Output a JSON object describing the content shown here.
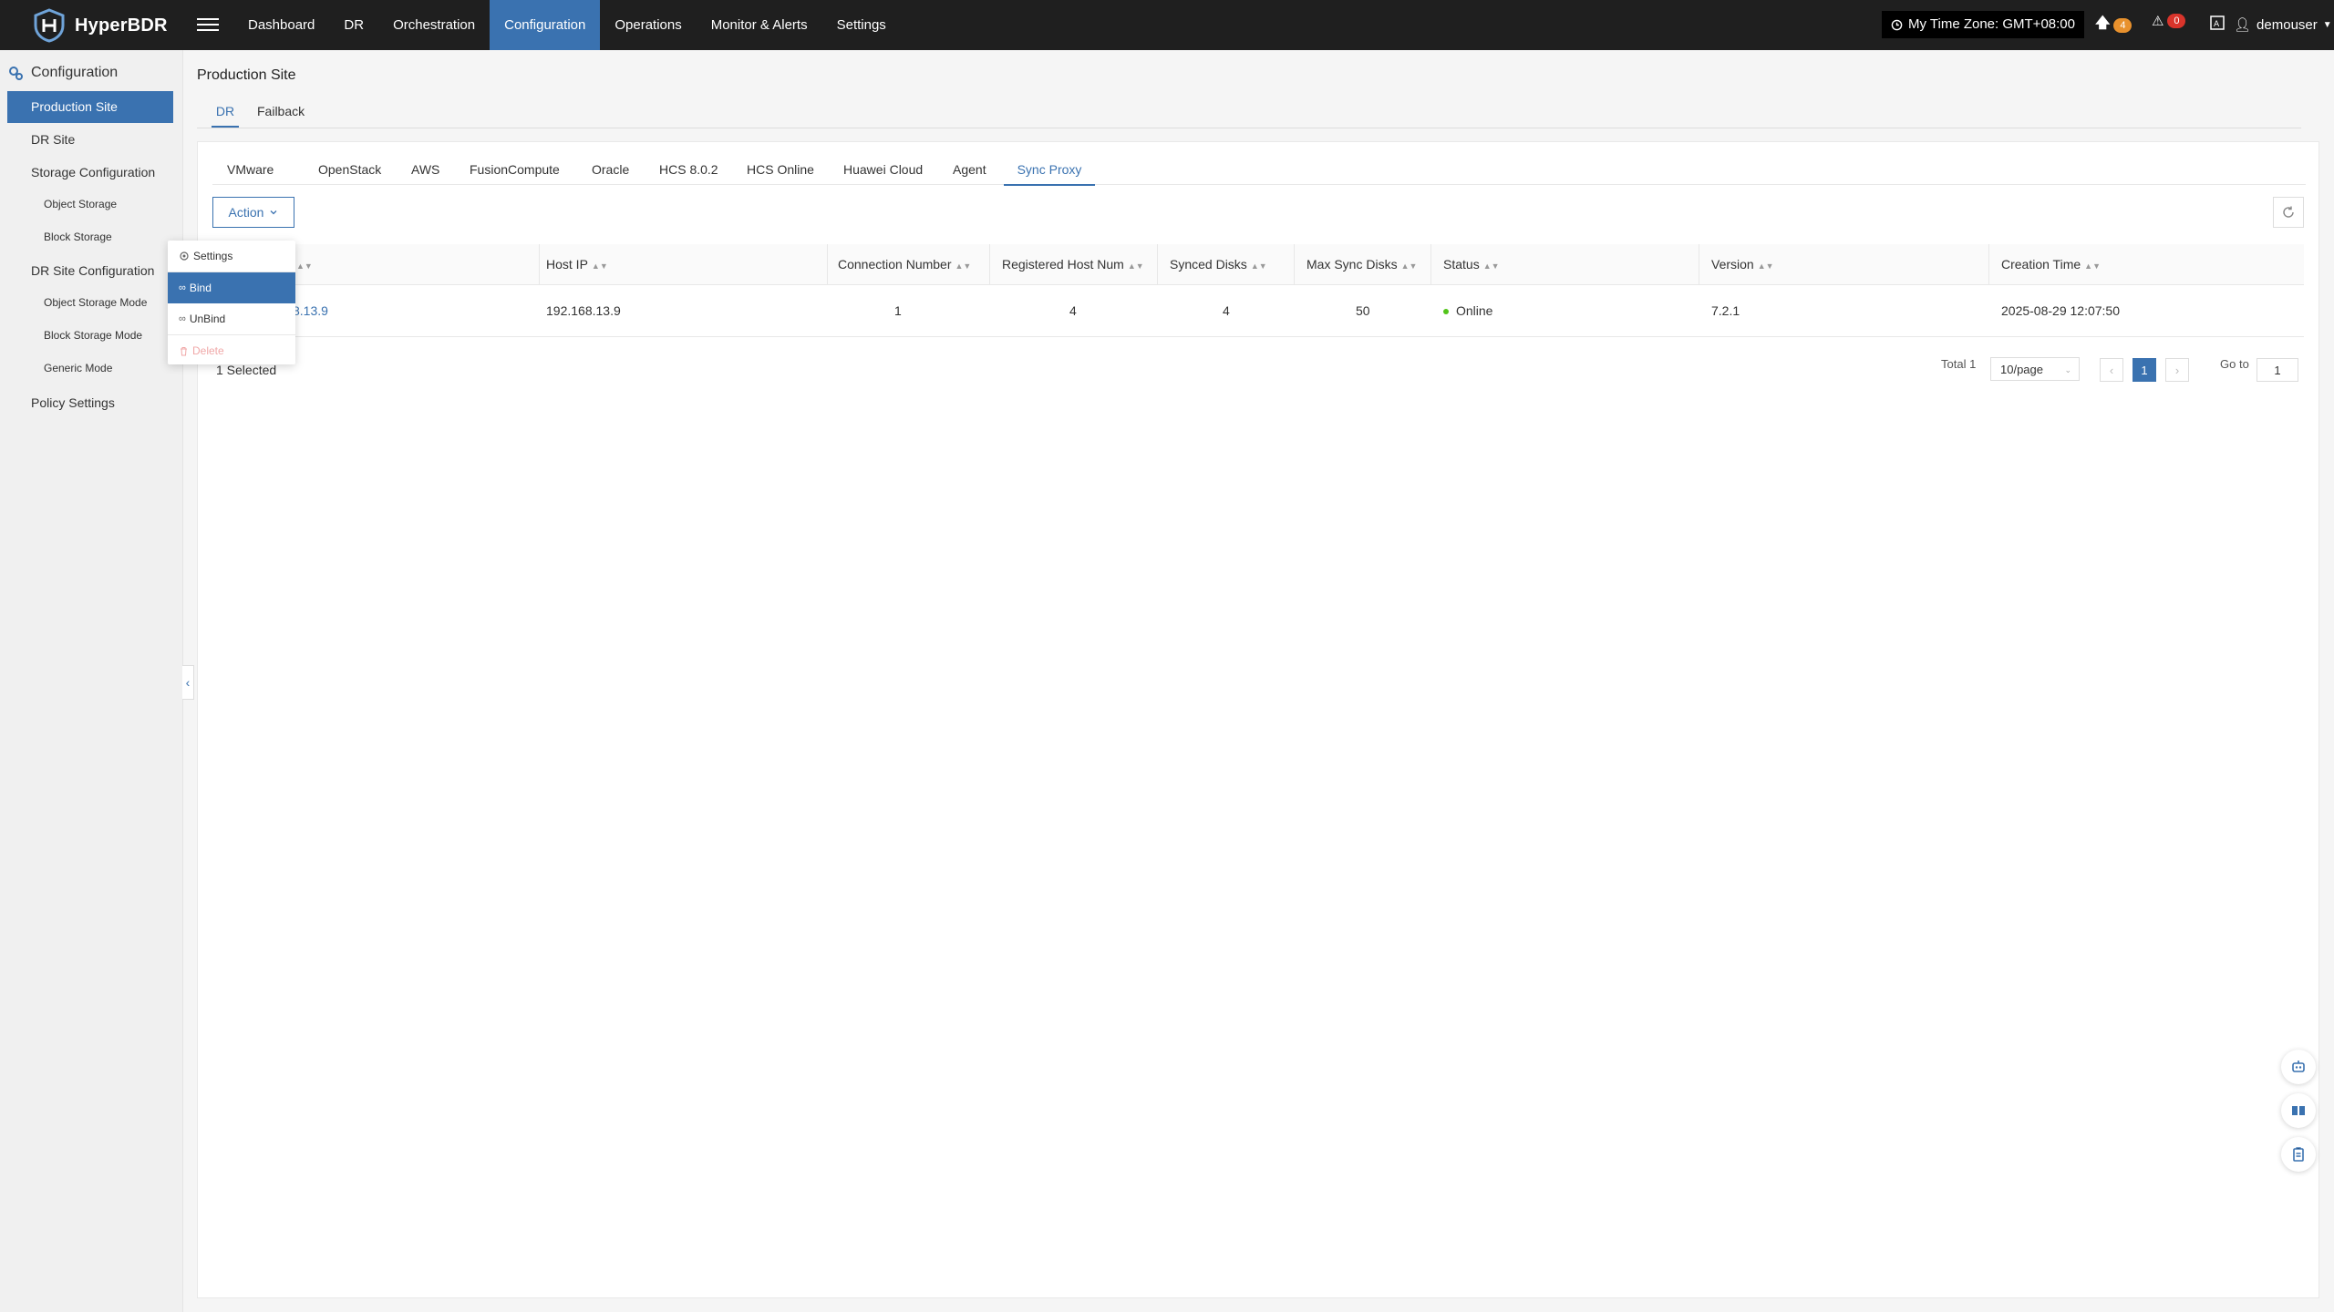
{
  "app": {
    "name": "HyperBDR"
  },
  "nav": {
    "items": [
      "Dashboard",
      "DR",
      "Orchestration",
      "Configuration",
      "Operations",
      "Monitor & Alerts",
      "Settings"
    ],
    "active": "Configuration"
  },
  "topbar": {
    "timezone": "My Time Zone: GMT+08:00",
    "upload_count": "4",
    "alert_count": "0",
    "user": "demouser"
  },
  "sidebar": {
    "header": "Configuration",
    "items": {
      "production_site": "Production Site",
      "dr_site": "DR Site",
      "storage_configuration": "Storage Configuration",
      "object_storage": "Object Storage",
      "block_storage": "Block Storage",
      "dr_site_configuration": "DR Site Configuration",
      "object_storage_mode": "Object Storage Mode",
      "block_storage_mode": "Block Storage Mode",
      "generic_mode": "Generic Mode",
      "policy_settings": "Policy Settings"
    }
  },
  "page": {
    "title": "Production Site",
    "subtabs": {
      "dr": "DR",
      "failback": "Failback"
    }
  },
  "platform_tabs": {
    "vmware": "VMware",
    "openstack": "OpenStack",
    "aws": "AWS",
    "fusioncompute": "FusionCompute",
    "oracle": "Oracle",
    "hcs802": "HCS 8.0.2",
    "hcs_online": "HCS Online",
    "huawei_cloud": "Huawei Cloud",
    "agent": "Agent",
    "sync_proxy": "Sync Proxy"
  },
  "toolbar": {
    "action_label": "Action"
  },
  "action_menu": {
    "settings": "Settings",
    "bind": "Bind",
    "unbind": "UnBind",
    "delete": "Delete"
  },
  "table": {
    "columns": {
      "host_ip": "Host IP",
      "connection_number": "Connection Number",
      "registered_host_num": "Registered Host Num",
      "synced_disks": "Synced Disks",
      "max_sync_disks": "Max Sync Disks",
      "status": "Status",
      "version": "Version",
      "creation_time": "Creation Time"
    },
    "rows": [
      {
        "name_visible": "8.13.9",
        "host_ip": "192.168.13.9",
        "connection_number": "1",
        "registered_host_num": "4",
        "synced_disks": "4",
        "max_sync_disks": "50",
        "status": "Online",
        "version": "7.2.1",
        "creation_time": "2025-08-29 12:07:50"
      }
    ]
  },
  "footer": {
    "selected": "1 Selected",
    "total": "Total 1",
    "page_size": "10/page",
    "current_page": "1",
    "goto_label": "Go to",
    "goto_value": "1"
  },
  "colors": {
    "accent": "#3a72b0",
    "topbar": "#1f1f1f",
    "online": "#52c41a",
    "upload_badge": "#e8912d",
    "alert_badge": "#d9342b"
  }
}
